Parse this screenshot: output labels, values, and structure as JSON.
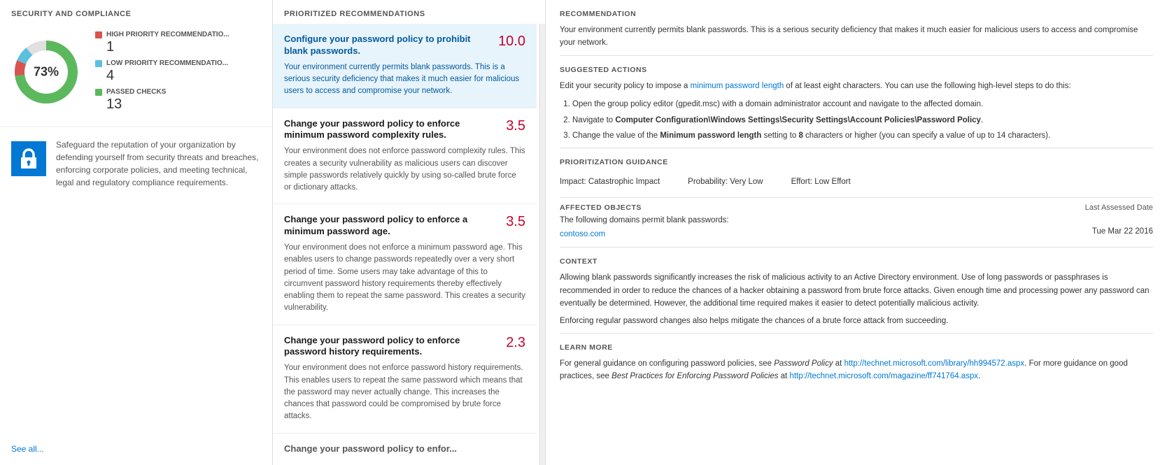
{
  "left_panel": {
    "title": "SECURITY AND COMPLIANCE",
    "donut": {
      "percentage": "73%",
      "segments": [
        {
          "color": "#5cb85c",
          "value": 73,
          "label": "passed"
        },
        {
          "color": "#d9534f",
          "value": 8,
          "label": "high"
        },
        {
          "color": "#5bc0de",
          "value": 8,
          "label": "low"
        },
        {
          "color": "#e0e0e0",
          "value": 11,
          "label": "remaining"
        }
      ]
    },
    "legend": [
      {
        "label": "HIGH PRIORITY RECOMMENDATIO...",
        "color": "#d9534f",
        "value": "1"
      },
      {
        "label": "LOW PRIORITY RECOMMENDATIO...",
        "color": "#5bc0de",
        "value": "4"
      },
      {
        "label": "PASSED CHECKS",
        "color": "#5cb85c",
        "value": "13"
      }
    ],
    "info_text": "Safeguard the reputation of your organization by defending yourself from security threats and breaches, enforcing corporate policies, and meeting technical, legal and regulatory compliance requirements.",
    "see_all_label": "See all..."
  },
  "middle_panel": {
    "title": "PRIORITIZED RECOMMENDATIONS",
    "recommendations": [
      {
        "title": "Configure your password policy to prohibit blank passwords.",
        "score": "10.0",
        "description": "Your environment currently permits blank passwords. This is a serious security deficiency that makes it much easier for malicious users to access and compromise your network.",
        "active": true
      },
      {
        "title": "Change your password policy to enforce minimum password complexity rules.",
        "score": "3.5",
        "description": "Your environment does not enforce password complexity rules. This creates a security vulnerability as malicious users can discover simple passwords relatively quickly by using so-called brute force or dictionary attacks.",
        "active": false
      },
      {
        "title": "Change your password policy to enforce a minimum password age.",
        "score": "3.5",
        "description": "Your environment does not enforce a minimum password age. This enables users to change passwords repeatedly over a very short period of time. Some users may take advantage of this to circumvent password history requirements thereby effectively enabling them to repeat the same password. This creates a security vulnerability.",
        "active": false
      },
      {
        "title": "Change your password policy to enforce password history requirements.",
        "score": "2.3",
        "description": "Your environment does not enforce password history requirements. This enables users to repeat the same password which means that the password may never actually change. This increases the chances that password could be compromised by brute force attacks.",
        "active": false
      },
      {
        "title": "Change your password policy to enfor...",
        "score": "",
        "description": "",
        "active": false,
        "truncated": true
      }
    ]
  },
  "right_panel": {
    "section_recommendation": "RECOMMENDATION",
    "recommendation_text": "Your environment currently permits blank passwords. This is a serious security deficiency that makes it much easier for malicious users to access and compromise your network.",
    "section_suggested": "SUGGESTED ACTIONS",
    "suggested_intro": "Edit your security policy to impose a minimum password length of at least eight characters. You can use the following high-level steps to do this:",
    "suggested_intro_link_text": "minimum password length",
    "actions": [
      "Open the group policy editor (gpedit.msc) with a domain administrator account and navigate to the affected domain.",
      "Navigate to Computer Configuration\\Windows Settings\\Security Settings\\Account Policies\\Password Policy.",
      "Change the value of the Minimum password length setting to 8 characters or higher (you can specify a value of up to 14 characters)."
    ],
    "section_prioritization": "PRIORITIZATION GUIDANCE",
    "prioritization": {
      "impact": "Impact: Catastrophic Impact",
      "probability": "Probability: Very Low",
      "effort": "Effort: Low Effort"
    },
    "section_affected": "AFFECTED OBJECTS",
    "last_assessed_label": "Last Assessed Date",
    "affected_text": "The following domains permit blank passwords:",
    "affected_domain": "contoso.com",
    "affected_date": "Tue Mar 22 2016",
    "section_context": "CONTEXT",
    "context_paragraphs": [
      "Allowing blank passwords significantly increases the risk of malicious activity to an Active Directory environment. Use of long passwords or passphrases is recommended in order to reduce the chances of a hacker obtaining a password from brute force attacks. Given enough time and processing power any password can eventually be determined. However, the additional time required makes it easier to detect potentially malicious activity.",
      "Enforcing regular password changes also helps mitigate the chances of a brute force attack from succeeding."
    ],
    "section_learn_more": "LEARN MORE",
    "learn_more_text_1": "For general guidance on configuring password policies, see ",
    "learn_more_italic_1": "Password Policy",
    "learn_more_text_2": " at ",
    "learn_more_link_1": "http://technet.microsoft.com/library/hh994572.aspx",
    "learn_more_text_3": ". For more guidance on good practices, see ",
    "learn_more_italic_2": "Best Practices for Enforcing Password Policies",
    "learn_more_text_4": " at ",
    "learn_more_link_2": "http://technet.microsoft.com/magazine/ff741764.aspx",
    "learn_more_text_5": "."
  }
}
